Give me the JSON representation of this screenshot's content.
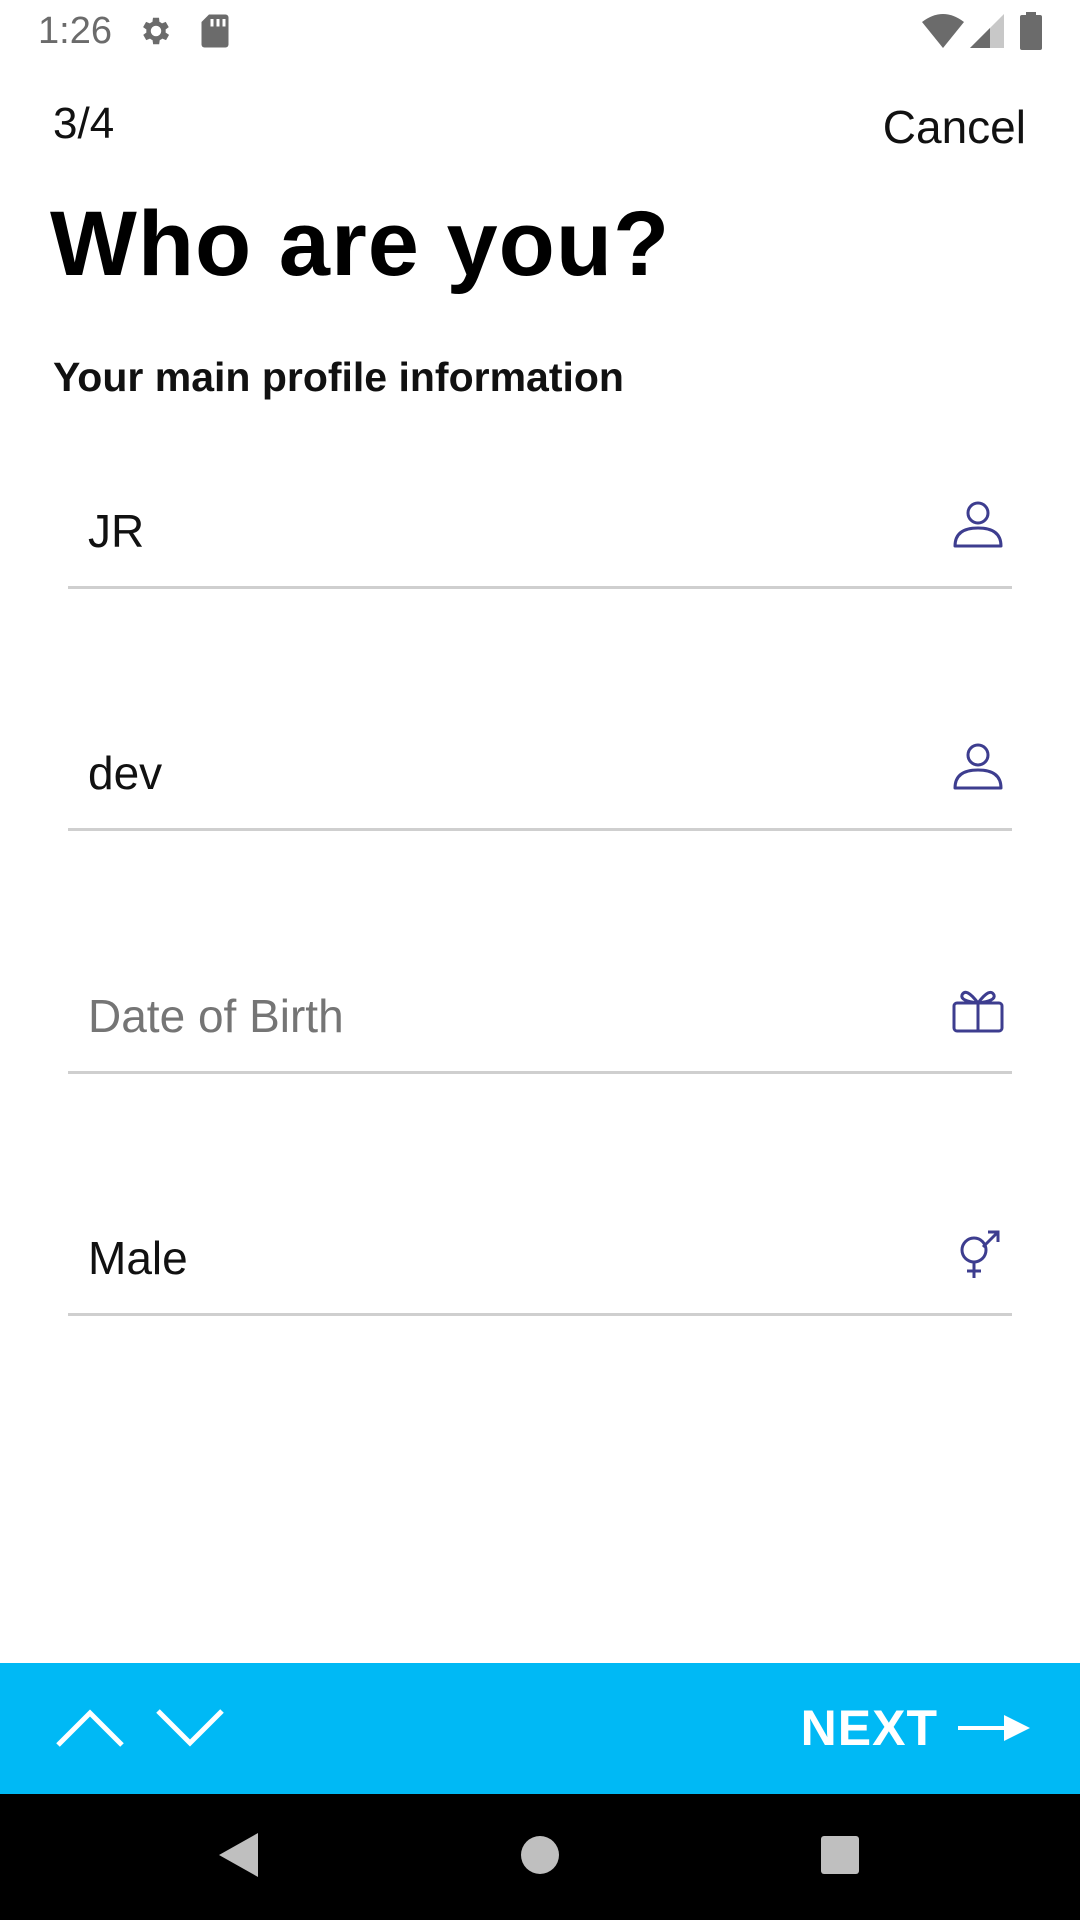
{
  "status_bar": {
    "time": "1:26",
    "icons": [
      "gear-icon",
      "sd-card-icon",
      "wifi-icon",
      "signal-icon",
      "battery-icon"
    ],
    "icon_color": "#6b6b6b"
  },
  "header": {
    "step": "3/4",
    "cancel_label": "Cancel"
  },
  "title": "Who are you?",
  "subtitle": "Your main profile information",
  "fields": [
    {
      "value": "JR",
      "placeholder": "",
      "icon": "person-icon"
    },
    {
      "value": "dev",
      "placeholder": "",
      "icon": "person-icon"
    },
    {
      "value": "",
      "placeholder": "Date of Birth",
      "icon": "gift-icon"
    },
    {
      "value": "Male",
      "placeholder": "",
      "icon": "gender-icon"
    }
  ],
  "action_bar": {
    "background": "#00b9f5",
    "next_label": "NEXT",
    "icons": [
      "chevron-up-icon",
      "chevron-down-icon",
      "arrow-right-icon"
    ]
  },
  "icon_accent": "#3d3d8f",
  "system_nav": {
    "icons": [
      "back-icon",
      "home-icon",
      "recents-icon"
    ]
  }
}
